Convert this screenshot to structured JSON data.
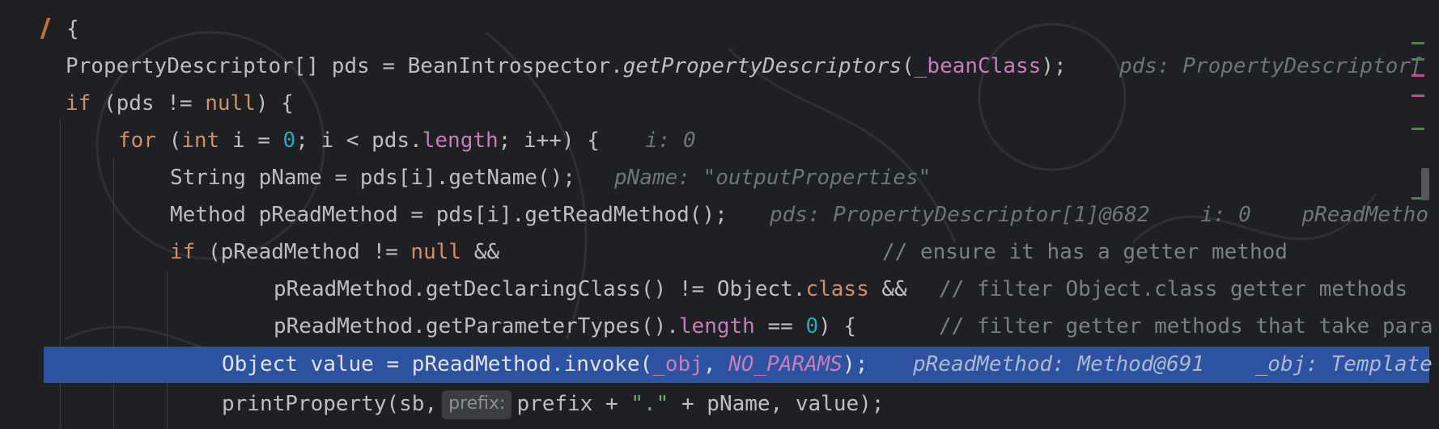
{
  "editor": {
    "lines": [
      {
        "id": "open-brace",
        "text": "{"
      },
      {
        "id": "pds-decl",
        "parts": [
          "PropertyDescriptor[] pds = BeanIntrospector.",
          "getPropertyDescriptors",
          "(",
          "_beanClass",
          ");"
        ],
        "hint": "pds: PropertyDescriptor["
      },
      {
        "id": "if-pds",
        "parts": [
          "if",
          " (pds != ",
          "null",
          ") {"
        ]
      },
      {
        "id": "for-loop",
        "parts": [
          "for",
          " (",
          "int",
          " i = ",
          "0",
          "; i < pds.",
          "length",
          "; i++) {"
        ],
        "hint": "i: 0"
      },
      {
        "id": "pname-decl",
        "text": "String pName = pds[i].getName();",
        "hint": "pName: \"outputProperties\""
      },
      {
        "id": "readmethod-decl",
        "text": "Method pReadMethod = pds[i].getReadMethod();",
        "hint": "pds: PropertyDescriptor[1]@682    i: 0    pReadMetho"
      },
      {
        "id": "if-readmethod",
        "parts": [
          "if",
          " (pReadMethod != ",
          "null",
          " &&"
        ],
        "comment": "// ensure it has a getter method"
      },
      {
        "id": "declaring-class",
        "parts": [
          "pReadMethod.getDeclaringClass() != Object.",
          "class",
          " &&"
        ],
        "comment": "// filter Object.class getter methods"
      },
      {
        "id": "param-types",
        "parts": [
          "pReadMethod.getParameterTypes().",
          "length",
          " == ",
          "0",
          ") {"
        ],
        "comment": "// filter getter methods that take para"
      },
      {
        "id": "invoke-line",
        "parts": [
          "Object value = pReadMethod.invoke(",
          "_obj",
          ", ",
          "NO_PARAMS",
          ");"
        ],
        "hint": "pReadMethod: Method@691    _obj: Template"
      },
      {
        "id": "print-property",
        "parts": [
          "printProperty(sb,",
          "prefix:",
          "prefix + ",
          "\".\"",
          " + pName, value);"
        ]
      }
    ]
  },
  "colors": {
    "background": "#1f2023",
    "keyword": "#cf8e6d",
    "number": "#2aacb8",
    "field": "#c77dbb",
    "comment": "#7a7e85",
    "string": "#6aab73",
    "hint": "#6f737a",
    "execution_line": "#2d52a0"
  }
}
